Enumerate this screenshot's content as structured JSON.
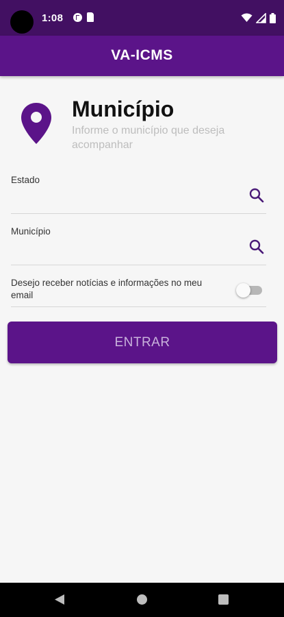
{
  "status_bar": {
    "time": "1:08"
  },
  "app_bar": {
    "title": "VA-ICMS"
  },
  "header": {
    "title": "Município",
    "subtitle": "Informe o município que deseja acompanhar"
  },
  "form": {
    "estado": {
      "label": "Estado",
      "value": ""
    },
    "municipio": {
      "label": "Município",
      "value": ""
    },
    "newsletter": {
      "label": "Desejo receber notícias e informações no meu email",
      "checked": false
    }
  },
  "actions": {
    "enter_label": "ENTRAR"
  },
  "colors": {
    "status_bar": "#421062",
    "primary": "#5b1489",
    "background": "#f6f6f6",
    "subtitle": "#bdbdbd",
    "button_text": "#c9b2dc"
  },
  "icons": {
    "location": "location-pin-icon",
    "search": "search-icon",
    "nav_back": "back-icon",
    "nav_home": "home-icon",
    "nav_recents": "recents-icon"
  }
}
